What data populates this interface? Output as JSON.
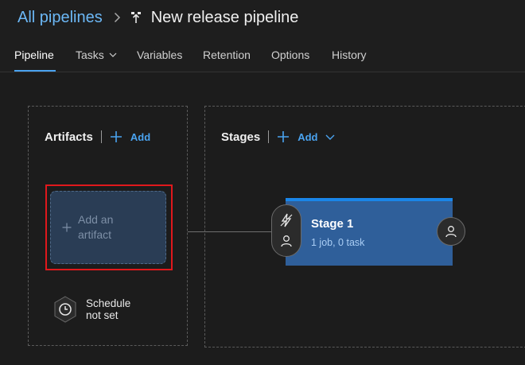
{
  "breadcrumb": {
    "root_label": "All pipelines",
    "separator_icon": "chevron-right-icon",
    "pipeline_icon": "release-pipeline-icon",
    "title": "New release pipeline"
  },
  "tabs": [
    {
      "label": "Pipeline",
      "active": true
    },
    {
      "label": "Tasks",
      "has_dropdown": true
    },
    {
      "label": "Variables"
    },
    {
      "label": "Retention"
    },
    {
      "label": "Options"
    },
    {
      "label": "History"
    }
  ],
  "artifacts": {
    "heading": "Artifacts",
    "add_label": "Add",
    "placeholder_label": "Add an artifact",
    "schedule_label_line1": "Schedule",
    "schedule_label_line2": "not set"
  },
  "stages": {
    "heading": "Stages",
    "add_label": "Add",
    "items": [
      {
        "name": "Stage 1",
        "jobs_link": "1 job",
        "tasks_text": ", 0 task"
      }
    ]
  },
  "colors": {
    "accent": "#4aa3f0",
    "stage_fill": "#2f5f9a",
    "highlight": "#e0181c"
  }
}
